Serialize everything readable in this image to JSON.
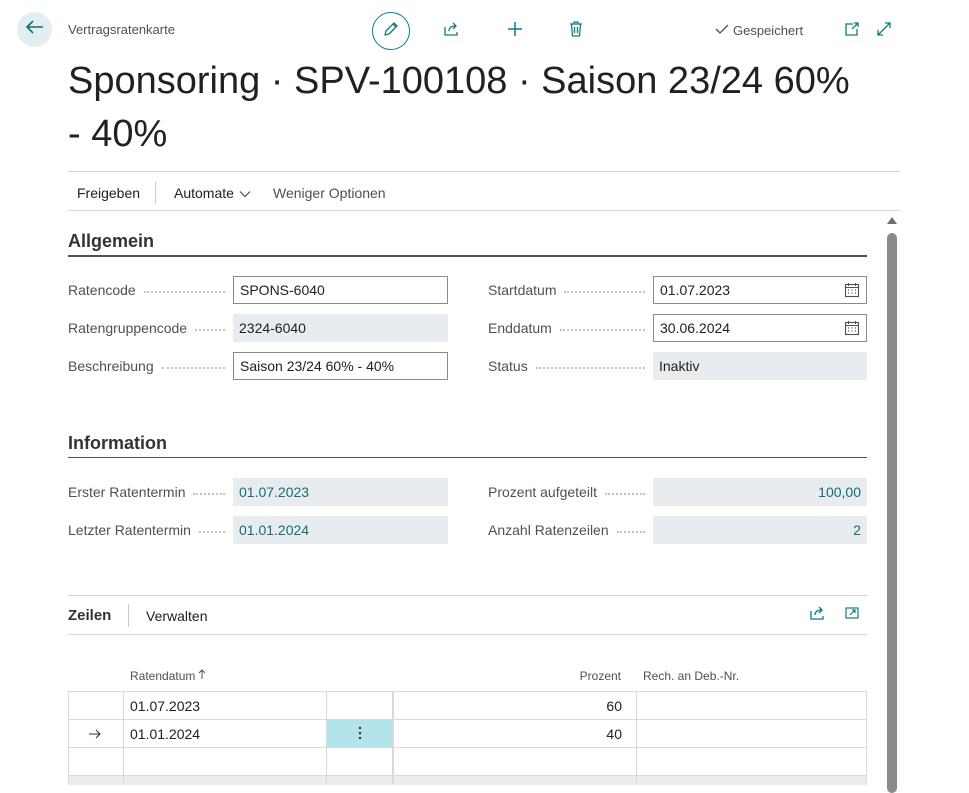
{
  "header": {
    "caption": "Vertragsratenkarte",
    "saved_status": "Gespeichert",
    "title": "Sponsoring · SPV-100108 · Saison 23/24 60% - 40%"
  },
  "actions": {
    "release": "Freigeben",
    "automate": "Automate",
    "fewer_options": "Weniger Optionen"
  },
  "general": {
    "section_title": "Allgemein",
    "rate_code_label": "Ratencode",
    "rate_code": "SPONS-6040",
    "rate_group_code_label": "Ratengruppencode",
    "rate_group_code": "2324-6040",
    "description_label": "Beschreibung",
    "description": "Saison 23/24 60% - 40%",
    "start_date_label": "Startdatum",
    "start_date": "01.07.2023",
    "end_date_label": "Enddatum",
    "end_date": "30.06.2024",
    "status_label": "Status",
    "status": "Inaktiv"
  },
  "information": {
    "section_title": "Information",
    "first_rate_label": "Erster Ratentermin",
    "first_rate": "01.07.2023",
    "last_rate_label": "Letzter Ratentermin",
    "last_rate": "01.01.2024",
    "percent_split_label": "Prozent aufgeteilt",
    "percent_split": "100,00",
    "line_count_label": "Anzahl Ratenzeilen",
    "line_count": "2"
  },
  "lines": {
    "title": "Zeilen",
    "manage": "Verwalten",
    "columns": {
      "rate_date": "Ratendatum",
      "percent": "Prozent",
      "invoice_to": "Rech. an Deb.-Nr."
    },
    "rows": [
      {
        "rate_date": "01.07.2023",
        "percent": "60",
        "invoice_to": ""
      },
      {
        "rate_date": "01.01.2024",
        "percent": "40",
        "invoice_to": ""
      },
      {
        "rate_date": "",
        "percent": "",
        "invoice_to": ""
      }
    ]
  },
  "colors": {
    "accent": "#0f7b84",
    "readonly_bg": "#e9ecee",
    "selected_cell": "#b3e4ea"
  },
  "icons": [
    "back-arrow-icon",
    "pencil-icon",
    "share-icon",
    "plus-icon",
    "trash-icon",
    "checkmark-icon",
    "open-new-window-icon",
    "expand-icon",
    "chevron-down-icon",
    "calendar-icon",
    "sort-ascending-icon",
    "row-arrow-icon",
    "more-vertical-icon"
  ]
}
